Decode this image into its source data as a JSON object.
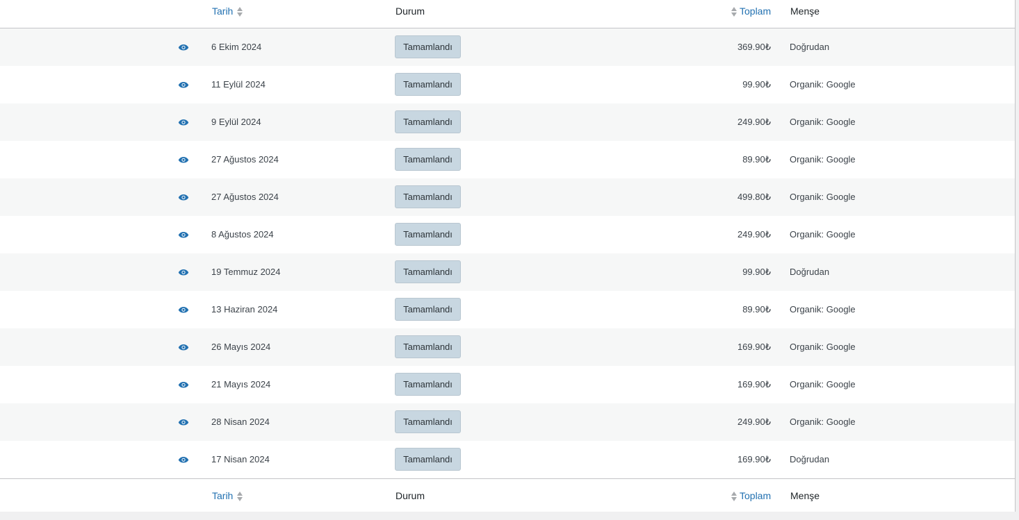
{
  "columns": {
    "date": "Tarih",
    "status": "Durum",
    "total": "Toplam",
    "origin": "Menşe"
  },
  "icons": {
    "view": "eye-icon",
    "sort": "sort-arrows-icon"
  },
  "colors": {
    "link": "#2271b1",
    "status_badge_bg": "#c8d7e1",
    "row_alt_bg": "#f6f7f7"
  },
  "orders": [
    {
      "date": "6 Ekim 2024",
      "status": "Tamamlandı",
      "total": "369.90₺",
      "origin": "Doğrudan"
    },
    {
      "date": "11 Eylül 2024",
      "status": "Tamamlandı",
      "total": "99.90₺",
      "origin": "Organik: Google"
    },
    {
      "date": "9 Eylül 2024",
      "status": "Tamamlandı",
      "total": "249.90₺",
      "origin": "Organik: Google"
    },
    {
      "date": "27 Ağustos 2024",
      "status": "Tamamlandı",
      "total": "89.90₺",
      "origin": "Organik: Google"
    },
    {
      "date": "27 Ağustos 2024",
      "status": "Tamamlandı",
      "total": "499.80₺",
      "origin": "Organik: Google"
    },
    {
      "date": "8 Ağustos 2024",
      "status": "Tamamlandı",
      "total": "249.90₺",
      "origin": "Organik: Google"
    },
    {
      "date": "19 Temmuz 2024",
      "status": "Tamamlandı",
      "total": "99.90₺",
      "origin": "Doğrudan"
    },
    {
      "date": "13 Haziran 2024",
      "status": "Tamamlandı",
      "total": "89.90₺",
      "origin": "Organik: Google"
    },
    {
      "date": "26 Mayıs 2024",
      "status": "Tamamlandı",
      "total": "169.90₺",
      "origin": "Organik: Google"
    },
    {
      "date": "21 Mayıs 2024",
      "status": "Tamamlandı",
      "total": "169.90₺",
      "origin": "Organik: Google"
    },
    {
      "date": "28 Nisan 2024",
      "status": "Tamamlandı",
      "total": "249.90₺",
      "origin": "Organik: Google"
    },
    {
      "date": "17 Nisan 2024",
      "status": "Tamamlandı",
      "total": "169.90₺",
      "origin": "Doğrudan"
    }
  ]
}
